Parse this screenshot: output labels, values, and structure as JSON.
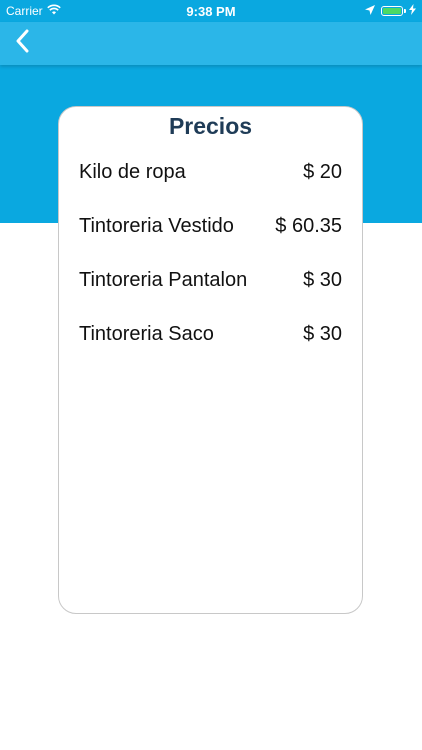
{
  "status_bar": {
    "carrier": "Carrier",
    "time": "9:38 PM",
    "battery_color": "#4cd964",
    "wifi_icon": "wifi-icon",
    "location_icon": "location-arrow-icon",
    "charging_icon": "lightning-bolt-icon"
  },
  "nav": {
    "back_icon": "chevron-left-icon"
  },
  "colors": {
    "top_band": "#0aa8e0",
    "nav_bar": "#2bb6e8",
    "title": "#1f3c57"
  },
  "card": {
    "title": "Precios",
    "items": [
      {
        "name": "Kilo de ropa",
        "price": "$ 20"
      },
      {
        "name": "Tintoreria Vestido",
        "price": "$ 60.35"
      },
      {
        "name": "Tintoreria Pantalon",
        "price": "$ 30"
      },
      {
        "name": "Tintoreria Saco",
        "price": "$ 30"
      }
    ]
  }
}
